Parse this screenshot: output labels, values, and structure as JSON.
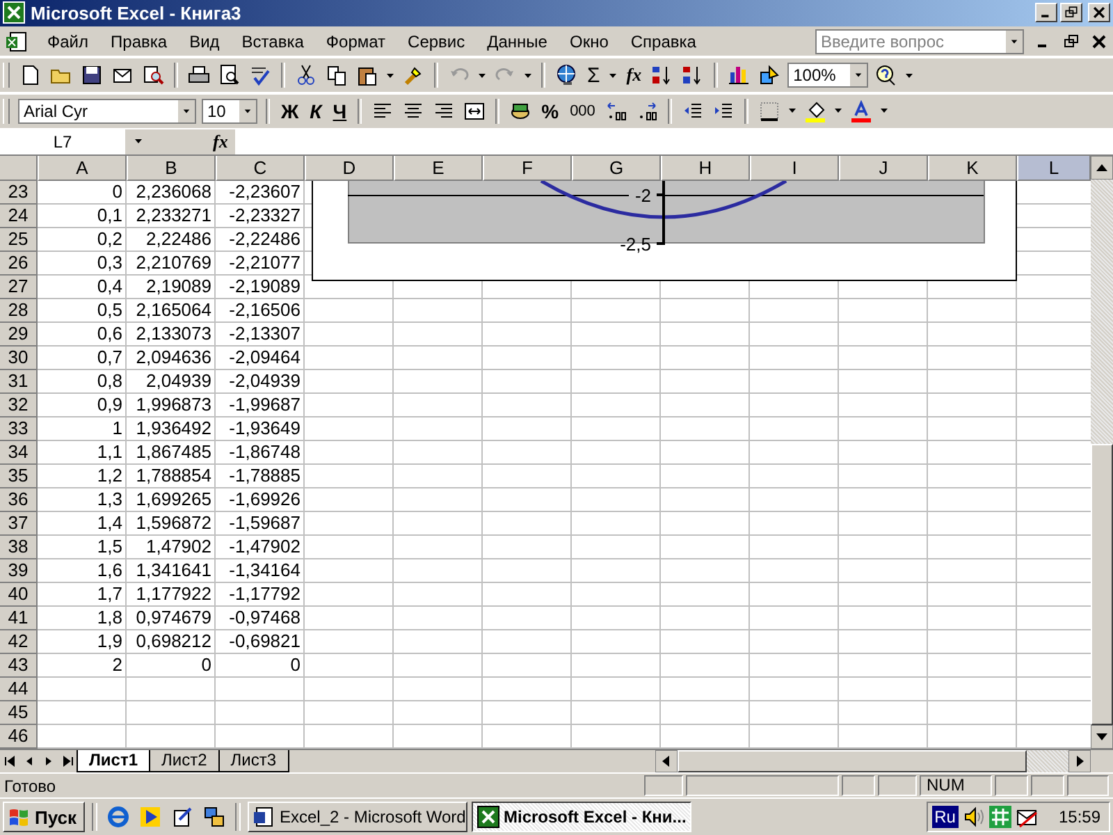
{
  "window": {
    "title": "Microsoft Excel - Книга3"
  },
  "menu": [
    "Файл",
    "Правка",
    "Вид",
    "Вставка",
    "Формат",
    "Сервис",
    "Данные",
    "Окно",
    "Справка"
  ],
  "help_search": {
    "placeholder": "Введите вопрос"
  },
  "toolbar": {
    "sum": "Σ",
    "function": "fx",
    "zoom": "100%"
  },
  "format_bar": {
    "font": "Arial Cyr",
    "size": "10",
    "bold": "Ж",
    "italic": "К",
    "underline": "Ч",
    "percent": "%",
    "thousands": "000"
  },
  "formula_bar": {
    "name_box": "L7",
    "fx": "fx"
  },
  "columns": [
    {
      "label": "A",
      "selected": false
    },
    {
      "label": "B",
      "selected": false
    },
    {
      "label": "C",
      "selected": false
    },
    {
      "label": "D",
      "selected": false
    },
    {
      "label": "E",
      "selected": false
    },
    {
      "label": "F",
      "selected": false
    },
    {
      "label": "G",
      "selected": false
    },
    {
      "label": "H",
      "selected": false
    },
    {
      "label": "I",
      "selected": false
    },
    {
      "label": "J",
      "selected": false
    },
    {
      "label": "K",
      "selected": false
    },
    {
      "label": "L",
      "selected": true
    }
  ],
  "rows": [
    {
      "number": "23",
      "cells": [
        "0",
        "2,236068",
        "-2,23607"
      ]
    },
    {
      "number": "24",
      "cells": [
        "0,1",
        "2,233271",
        "-2,23327"
      ]
    },
    {
      "number": "25",
      "cells": [
        "0,2",
        "2,22486",
        "-2,22486"
      ]
    },
    {
      "number": "26",
      "cells": [
        "0,3",
        "2,210769",
        "-2,21077"
      ]
    },
    {
      "number": "27",
      "cells": [
        "0,4",
        "2,19089",
        "-2,19089"
      ]
    },
    {
      "number": "28",
      "cells": [
        "0,5",
        "2,165064",
        "-2,16506"
      ]
    },
    {
      "number": "29",
      "cells": [
        "0,6",
        "2,133073",
        "-2,13307"
      ]
    },
    {
      "number": "30",
      "cells": [
        "0,7",
        "2,094636",
        "-2,09464"
      ]
    },
    {
      "number": "31",
      "cells": [
        "0,8",
        "2,04939",
        "-2,04939"
      ]
    },
    {
      "number": "32",
      "cells": [
        "0,9",
        "1,996873",
        "-1,99687"
      ]
    },
    {
      "number": "33",
      "cells": [
        "1",
        "1,936492",
        "-1,93649"
      ]
    },
    {
      "number": "34",
      "cells": [
        "1,1",
        "1,867485",
        "-1,86748"
      ]
    },
    {
      "number": "35",
      "cells": [
        "1,2",
        "1,788854",
        "-1,78885"
      ]
    },
    {
      "number": "36",
      "cells": [
        "1,3",
        "1,699265",
        "-1,69926"
      ]
    },
    {
      "number": "37",
      "cells": [
        "1,4",
        "1,596872",
        "-1,59687"
      ]
    },
    {
      "number": "38",
      "cells": [
        "1,5",
        "1,47902",
        "-1,47902"
      ]
    },
    {
      "number": "39",
      "cells": [
        "1,6",
        "1,341641",
        "-1,34164"
      ]
    },
    {
      "number": "40",
      "cells": [
        "1,7",
        "1,177922",
        "-1,17792"
      ]
    },
    {
      "number": "41",
      "cells": [
        "1,8",
        "0,974679",
        "-0,97468"
      ]
    },
    {
      "number": "42",
      "cells": [
        "1,9",
        "0,698212",
        "-0,69821"
      ]
    },
    {
      "number": "43",
      "cells": [
        "2",
        "0",
        "0"
      ]
    },
    {
      "number": "44"
    },
    {
      "number": "45"
    },
    {
      "number": "46"
    }
  ],
  "chart": {
    "tick_labels": [
      "-2",
      "-2,5"
    ]
  },
  "sheet_tabs": [
    {
      "label": "Лист1",
      "selected": true
    },
    {
      "label": "Лист2",
      "selected": false
    },
    {
      "label": "Лист3",
      "selected": false
    }
  ],
  "status_bar": {
    "text": "Готово",
    "indicators": [
      "NUM"
    ]
  },
  "taskbar": {
    "start": "Пуск",
    "tasks": [
      {
        "label": "Excel_2 - Microsoft Word",
        "selected": false
      },
      {
        "label": "Microsoft Excel - Кни...",
        "selected": true
      }
    ],
    "language": "Ru",
    "clock": "15:59"
  }
}
